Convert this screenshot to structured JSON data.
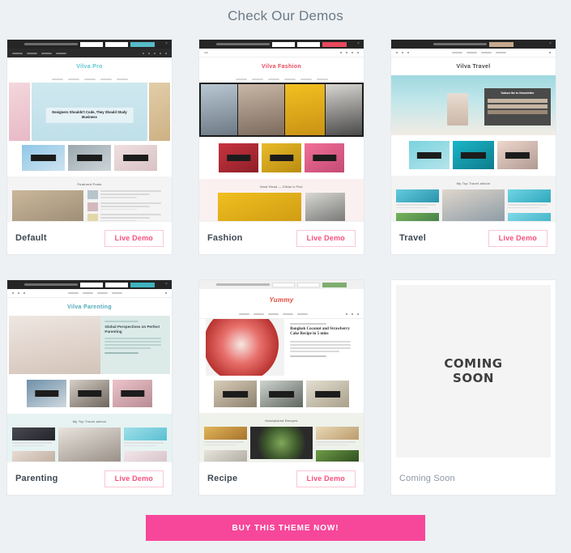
{
  "heading": "Check Our Demos",
  "colors": {
    "page_background": "#edf1f4",
    "heading_text": "#6b7a86",
    "card_background": "#ffffff",
    "live_demo_text": "#f8507f",
    "live_demo_border": "#fbc6d5",
    "cta_background": "#f7479a",
    "cta_text": "#ffffff",
    "coming_soon_placeholder": "#f4f4f4"
  },
  "cards": [
    {
      "id": "default",
      "title": "Default",
      "button_label": "Live Demo",
      "has_button": true,
      "preview": {
        "brand": "Vilva Pro",
        "brand_color": "#5fc7d4",
        "topbar_button_color": "#57bcc8",
        "hero_caption": "Designers Shouldn't Code, They Should Study Business",
        "section_title": "Featured Posts",
        "hero_bg": "#cfe8ef",
        "band_bg": "#f4f4f4"
      }
    },
    {
      "id": "fashion",
      "title": "Fashion",
      "button_label": "Live Demo",
      "has_button": true,
      "preview": {
        "brand": "Vilva Fashion",
        "brand_color": "#e8485c",
        "topbar_button_color": "#e8485c",
        "hero_caption": "",
        "section_title": "Must Read — Editor's Pick",
        "hero_bg": "#1c1c1c",
        "band_bg": "#fbf0f0"
      }
    },
    {
      "id": "travel",
      "title": "Travel",
      "button_label": "Live Demo",
      "has_button": true,
      "preview": {
        "brand": "Vilva Travel",
        "brand_color": "#4d4d4d",
        "topbar_button_color": "#c6a98e",
        "hero_caption": "Subscribe to Newsletter",
        "section_title": "My Top Travel advice",
        "hero_bg": "#9fd8e0",
        "band_bg": "#f3f3f3"
      }
    },
    {
      "id": "parenting",
      "title": "Parenting",
      "button_label": "Live Demo",
      "has_button": true,
      "preview": {
        "brand": "Vilva Parenting",
        "brand_color": "#4fa9b8",
        "topbar_button_color": "#3fb3bf",
        "hero_caption": "Global Perspectives on Perfect Parenting",
        "section_title": "My Top Travel advice",
        "hero_bg": "#efe7e2",
        "band_bg": "#e6f3f2"
      }
    },
    {
      "id": "recipe",
      "title": "Recipe",
      "button_label": "Live Demo",
      "has_button": true,
      "preview": {
        "brand": "Yummy",
        "brand_color": "#e34a3c",
        "topbar_button_color": "#7fae6e",
        "hero_caption": "Bangkok Coconut and Strawberry Cake Recipe in 5 mins",
        "section_title": "Handpicked Recipes",
        "hero_bg": "#ffffff",
        "band_bg": "#eef2ea"
      }
    },
    {
      "id": "coming-soon",
      "title": "Coming Soon",
      "button_label": "",
      "has_button": false,
      "preview": {
        "placeholder_line1": "COMING",
        "placeholder_line2": "SOON"
      }
    }
  ],
  "cta": {
    "label": "BUY THIS THEME NOW!"
  }
}
